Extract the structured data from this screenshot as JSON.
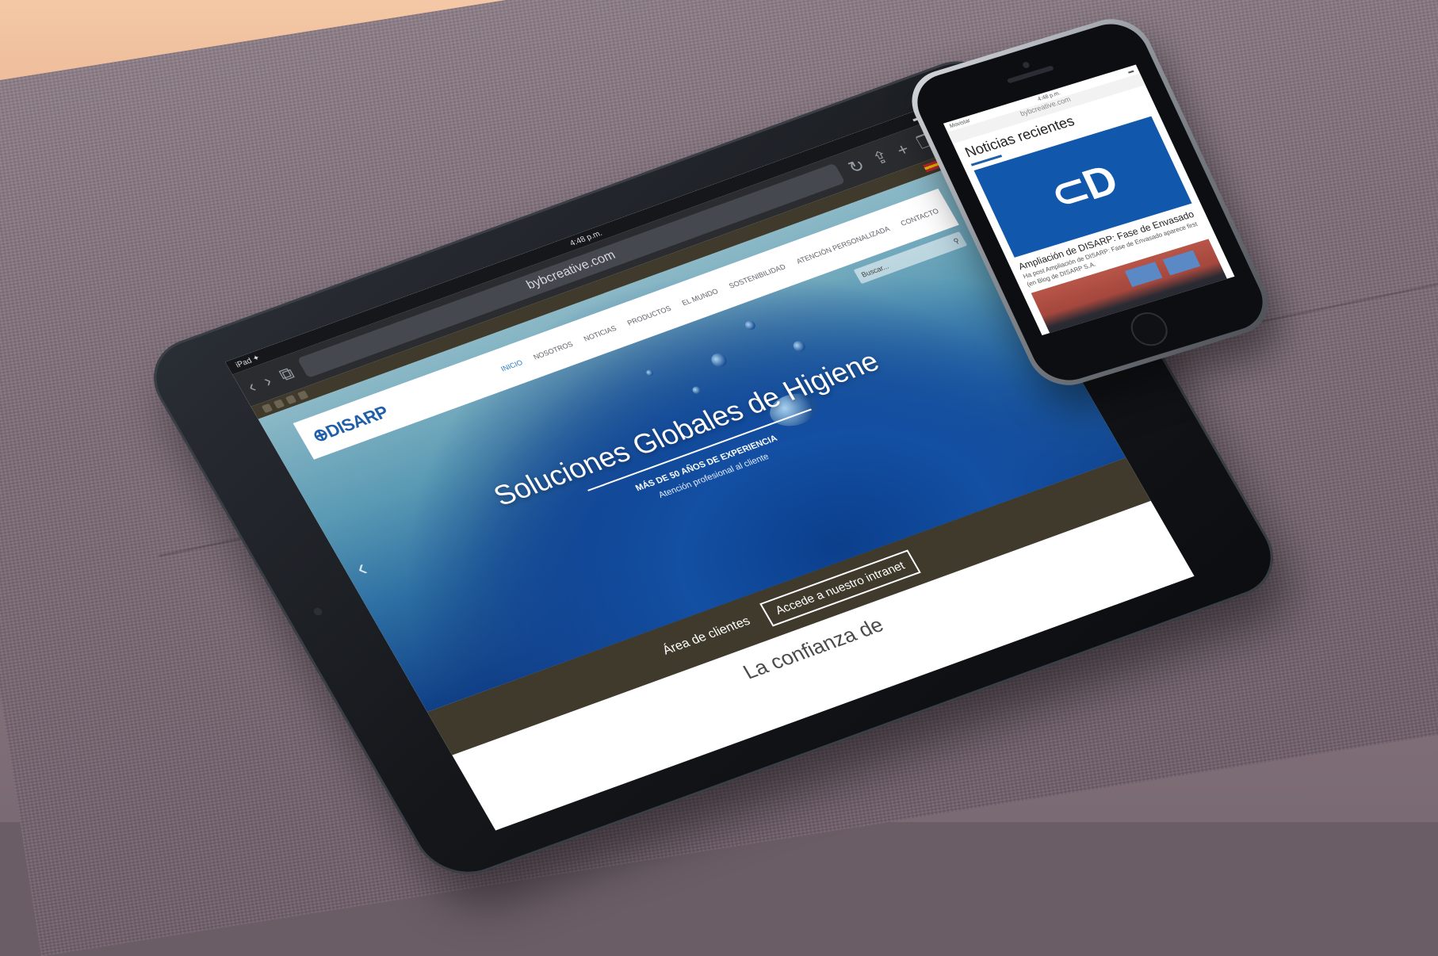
{
  "tablet": {
    "status": {
      "device": "iPad ✦",
      "time": "4:48 p.m.",
      "battery": "▬"
    },
    "browser": {
      "back_icon": "chevron-left-icon",
      "forward_icon": "chevron-right-icon",
      "bookmarks_icon": "book-icon",
      "url": "bybcreative.com",
      "reload_icon": "reload-icon",
      "share_icon": "share-icon",
      "add_icon": "plus-icon",
      "tabs_icon": "tabs-icon"
    },
    "site": {
      "logo": "⊕DISARP",
      "menu": [
        "Inicio",
        "Nosotros",
        "Noticias",
        "Productos",
        "El Mundo",
        "Sostenibilidad",
        "Atención Personalizada",
        "Contacto"
      ],
      "active_menu": "Inicio",
      "search_placeholder": "Buscar...",
      "search_icon": "search-icon",
      "hero_title": "Soluciones Globales de Higiene",
      "hero_sub1": "Más de 50 años de experiencia",
      "hero_sub2": "Atención profesional al cliente",
      "prev_arrow": "‹",
      "next_arrow": "›",
      "client_label": "Área de clientes",
      "intranet_button": "Accede a nuestro intranet",
      "tagline": "La confianza de"
    }
  },
  "phone": {
    "status": {
      "carrier": "Movistar",
      "time": "4:48 p.m.",
      "battery": "▬"
    },
    "url": "bybcreative.com",
    "heading": "Noticias recientes",
    "card_logo": "⊂D",
    "news_title": "Ampliación de DISARP: Fase de Envasado",
    "news_excerpt": "Ha post Ampliación de DISARP: Fase de Envasado aparece first (en Blog de DISARP S.A."
  },
  "colors": {
    "brand_blue": "#1f5ea8",
    "strip_olive": "#3f3a2c",
    "card_blue": "#1157ac"
  }
}
